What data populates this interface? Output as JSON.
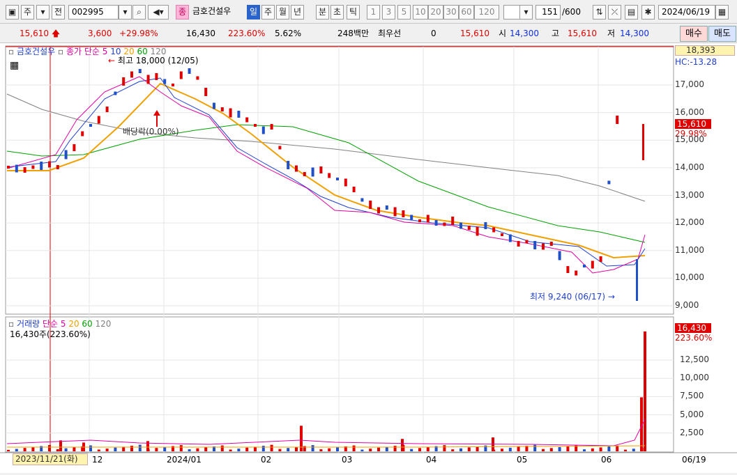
{
  "toolbar": {
    "market_type": "주",
    "prefix": "전",
    "code": "002995",
    "name_badge": "종",
    "stock_name": "금호건설우",
    "periods": [
      "일",
      "주",
      "월",
      "년",
      "분",
      "초",
      "틱"
    ],
    "active_period": "일",
    "minute_options": [
      "1",
      "3",
      "5",
      "10",
      "20",
      "30",
      "60",
      "120"
    ],
    "count": "151",
    "max_count": "/600",
    "date": "2024/06/19"
  },
  "quote": {
    "price": "15,610",
    "change": "3,600",
    "change_pct": "+29.98%",
    "volume": "16,430",
    "volume_pct": "223.60%",
    "turnover": "5.62%",
    "amount": "248백만",
    "broker": "최우선",
    "broker_val": "0",
    "current": "15,610",
    "open_label": "시",
    "open": "14,300",
    "high_label": "고",
    "high": "15,610",
    "low_label": "저",
    "low": "14,300",
    "buy": "매수",
    "sell": "매도"
  },
  "price_panel": {
    "legend_name": "금호건설우",
    "legend_ma": "종가 단순",
    "ma_periods": [
      "5",
      "10",
      "20",
      "60",
      "120"
    ],
    "ma_colors": [
      "#e000a0",
      "#1f3fd0",
      "#f0a000",
      "#00a000",
      "#808080"
    ],
    "high_note": "최고 18,000 (12/05)",
    "low_note": "최저 9,240 (06/17)",
    "dividend_note": "배당락(0.00%)",
    "axis_top": "18,393",
    "axis_hc": "HC:-13.28",
    "cur_price": "15,610",
    "cur_pct": "29.98%",
    "y_ticks": [
      "17,000",
      "16,000",
      "15,000",
      "14,000",
      "13,000",
      "12,000",
      "11,000",
      "10,000",
      "9,000"
    ]
  },
  "volume_panel": {
    "legend_name": "거래량",
    "legend_ma": "단순",
    "ma_periods": [
      "5",
      "20",
      "60",
      "120"
    ],
    "vol_line": "16,430주(223.60%)",
    "cur_vol": "16,430",
    "cur_pct": "223.60%",
    "y_ticks": [
      "12,500",
      "10,000",
      "7,500",
      "5,000",
      "2,500"
    ]
  },
  "x_axis": {
    "cursor_date": "2023/11/21(화)",
    "labels": [
      "12",
      "2024/01",
      "02",
      "03",
      "04",
      "05",
      "06"
    ],
    "right_label": "06/19"
  },
  "colors": {
    "up": "#e00000",
    "down": "#1f50c8",
    "accent": "#2a63c9"
  }
}
